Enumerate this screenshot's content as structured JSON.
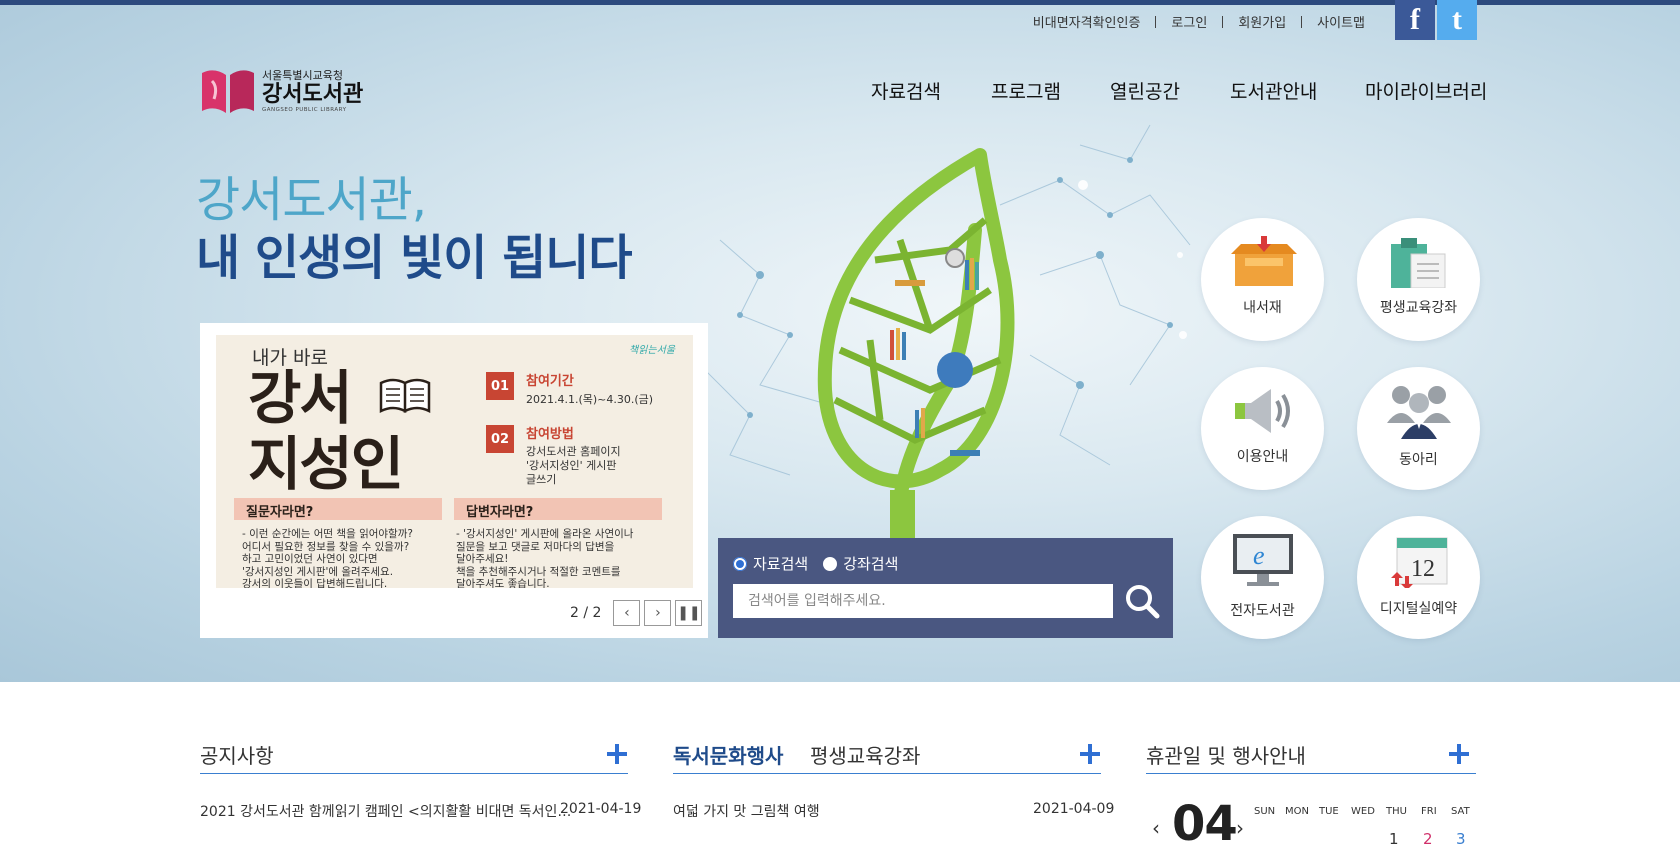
{
  "util_nav": {
    "items": [
      "비대면자격확인인증",
      "로그인",
      "회원가입",
      "사이트맵"
    ],
    "facebook": "f",
    "twitter": "t"
  },
  "logo": {
    "sub": "서울특별시교육청",
    "main": "강서도서관",
    "eng": "GANGSEO PUBLIC LIBRARY"
  },
  "gnb": [
    "자료검색",
    "프로그램",
    "열린공간",
    "도서관안내",
    "마이라이브러리"
  ],
  "slogan": {
    "line1": "강서도서관,",
    "line2": "내 인생의 빛이 됩니다"
  },
  "banner": {
    "small_title": "내가 바로",
    "big_title_1": "강서",
    "big_title_2": "지성인",
    "brand": "책읽는서울",
    "part1_label": "PART 01",
    "part1_head": "참여기간",
    "part1_text": "2021.4.1.(목)~4.30.(금)",
    "part2_label": "PART 02",
    "part2_head": "참여방법",
    "part2_text": [
      "강서도서관 홈페이지",
      "'강서지성인' 게시판",
      "글쓰기"
    ],
    "q_head": "질문자라면?",
    "q_text": [
      "- 이런 순간에는 어떤 책을 읽어야할까?",
      "어디서 필요한 정보를 찾을 수 있을까?",
      "하고 고민이었던 사연이 있다면",
      "'강서지성인 게시판'에 올려주세요.",
      "강서의 이웃들이 답변해드립니다."
    ],
    "a_head": "답변자라면?",
    "a_text": [
      "- '강서지성인' 게시판에 올라온 사연이나",
      "질문을 보고 댓글로 저마다의 답변을",
      "달아주세요!",
      "책을 추천해주시거나 적절한 코멘트를",
      "달아주셔도 좋습니다."
    ],
    "counter": "2 / 2"
  },
  "search": {
    "option1": "자료검색",
    "option2": "강좌검색",
    "placeholder": "검색어를 입력해주세요."
  },
  "quick_menu": [
    "내서재",
    "평생교육강좌",
    "이용안내",
    "동아리",
    "전자도서관",
    "디지털실예약"
  ],
  "notice": {
    "title": "공지사항",
    "item": "2021 강서도서관 함께읽기 캠페인 <의지활활 비대면 독서인…",
    "date": "2021-04-19"
  },
  "events": {
    "tab1": "독서문화행사",
    "tab2": "평생교육강좌",
    "item": "여덟 가지 맛 그림책 여행",
    "date": "2021-04-09"
  },
  "calendar": {
    "title": "휴관일 및 행사안내",
    "month": "04",
    "days": [
      "SUN",
      "MON",
      "TUE",
      "WED",
      "THU",
      "FRI",
      "SAT"
    ],
    "nums": [
      "1",
      "2",
      "3"
    ],
    "colors": {
      "sat": "#3a7fd0",
      "fri": "#d0306a"
    }
  },
  "colors": {
    "accent": "#1f4b8a",
    "line": "#3a7fd0",
    "search_bg": "#4a5781"
  }
}
